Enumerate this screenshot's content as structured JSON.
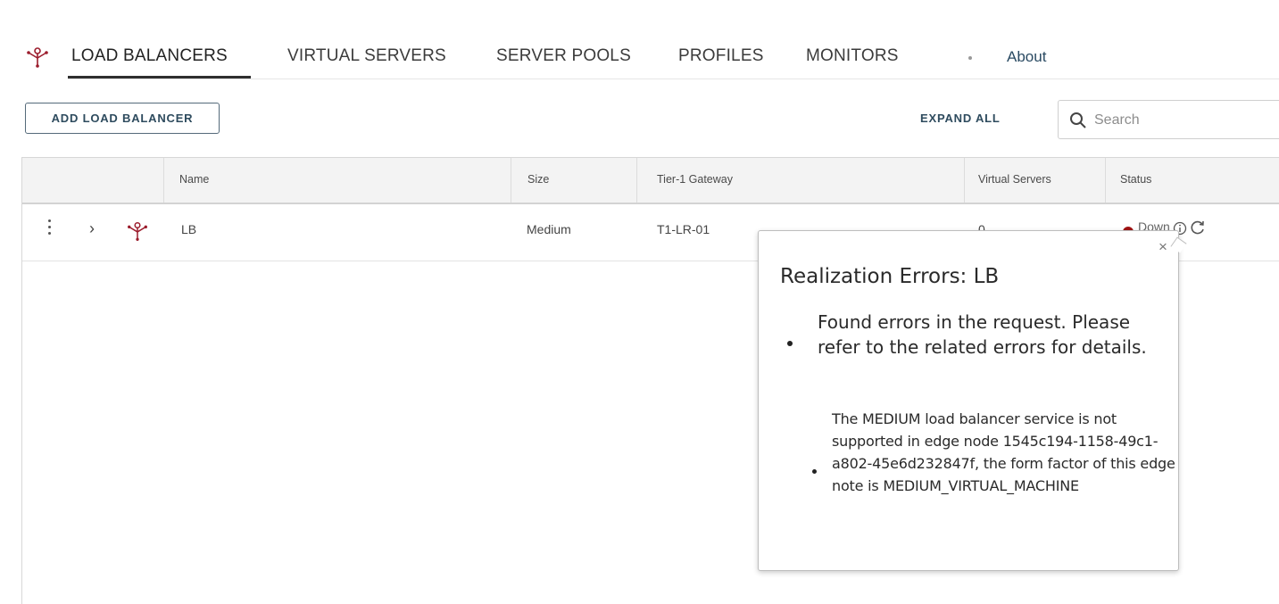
{
  "nav": {
    "tabs": [
      {
        "label": "LOAD BALANCERS",
        "active": true
      },
      {
        "label": "VIRTUAL SERVERS"
      },
      {
        "label": "SERVER POOLS"
      },
      {
        "label": "PROFILES"
      },
      {
        "label": "MONITORS"
      }
    ],
    "about": "About",
    "logo_icon": "load-balancer-icon"
  },
  "toolbar": {
    "add_label": "ADD LOAD BALANCER",
    "expand_label": "EXPAND ALL",
    "search_placeholder": "Search"
  },
  "table": {
    "columns": [
      "Name",
      "Size",
      "Tier-1 Gateway",
      "Virtual Servers",
      "Status"
    ],
    "rows": [
      {
        "name": "LB",
        "size": "Medium",
        "gateway": "T1-LR-01",
        "virtual_servers": "0",
        "status": "Down"
      }
    ]
  },
  "popover": {
    "close": "×",
    "title": "Realization Errors: LB",
    "message1": "Found errors in the request. Please refer to the related errors for details.",
    "message2": "The MEDIUM load balancer service is not supported in edge node 1545c194-1158-49c1-a802-45e6d232847f, the form factor of this edge note is MEDIUM_VIRTUAL_MACHINE"
  },
  "colors": {
    "status_down": "#a01313",
    "accent": "#2e4b5e",
    "icon_red": "#9b1c2c"
  }
}
